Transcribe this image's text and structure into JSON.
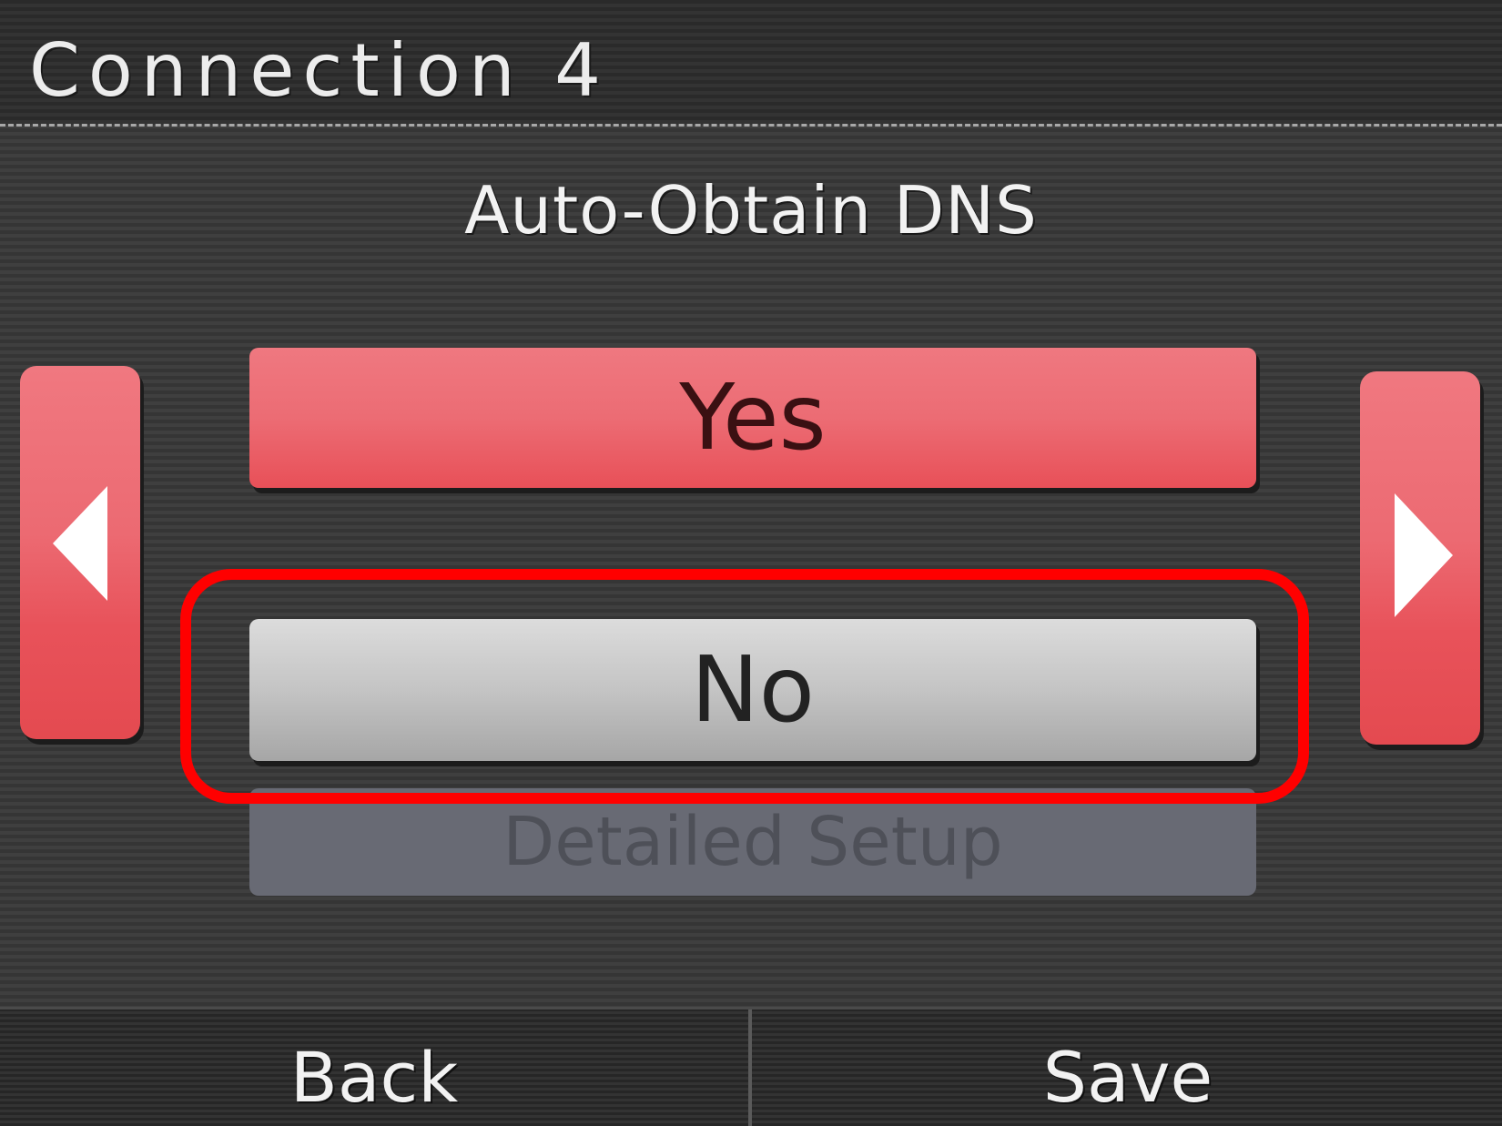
{
  "header": {
    "title": "Connection 4"
  },
  "setting": {
    "label": "Auto-Obtain DNS"
  },
  "options": {
    "yes_label": "Yes",
    "no_label": "No",
    "detailed_label": "Detailed Setup"
  },
  "nav": {
    "left_icon": "arrow-left-icon",
    "right_icon": "arrow-right-icon"
  },
  "footer": {
    "back_label": "Back",
    "save_label": "Save"
  },
  "colors": {
    "accent": "#ec6a72",
    "highlight": "#ff0000",
    "selected_option": "#c4c4c4",
    "disabled_option": "#686a74"
  }
}
